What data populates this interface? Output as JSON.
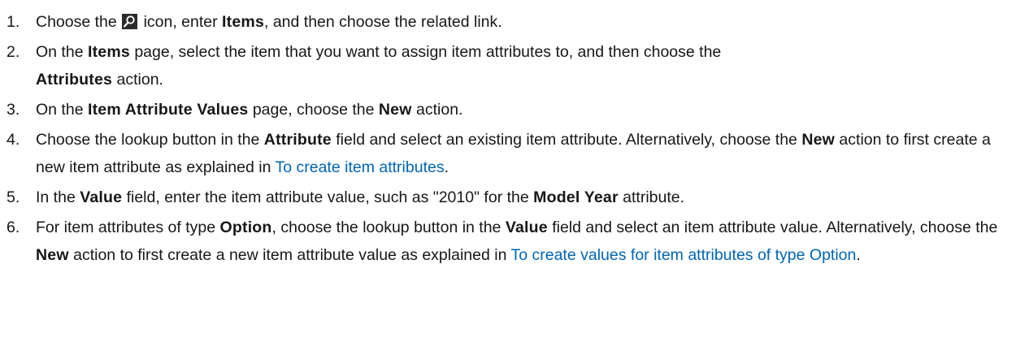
{
  "steps": [
    {
      "num": "1.",
      "t1": "Choose the ",
      "icon": "search-icon",
      "t2": " icon, enter ",
      "b1": "Items",
      "t3": ", and then choose the related link."
    },
    {
      "num": "2.",
      "t1": "On the ",
      "b1": "Items",
      "t2": " page, select the item that you want to assign item attributes to, and then choose the ",
      "b2": "Attributes",
      "t3": " action."
    },
    {
      "num": "3.",
      "t1": "On the ",
      "b1": "Item Attribute Values",
      "t2": " page, choose the ",
      "b2": "New",
      "t3": " action."
    },
    {
      "num": "4.",
      "t1": "Choose the lookup button in the ",
      "b1": "Attribute",
      "t2": " field and select an existing item attribute. Alternatively, choose the ",
      "b2": "New",
      "t3": " action to first create a new item attribute as explained in ",
      "link": "To create item attributes",
      "t4": "."
    },
    {
      "num": "5.",
      "t1": "In the ",
      "b1": "Value",
      "t2": " field, enter the item attribute value, such as \"2010\" for the ",
      "b2": "Model Year",
      "t3": " attribute."
    },
    {
      "num": "6.",
      "t1": "For item attributes of type ",
      "b1": "Option",
      "t2": ", choose the lookup button in the ",
      "b2": "Value",
      "t3": " field and select an item attribute value. Alternatively, choose the ",
      "b3": "New",
      "t4": " action to first create a new item attribute value as explained in ",
      "link": "To create values for item attributes of type Option",
      "t5": "."
    }
  ],
  "colors": {
    "text": "#171717",
    "link": "#0065b3",
    "icon_bg": "#2b2b2b"
  }
}
